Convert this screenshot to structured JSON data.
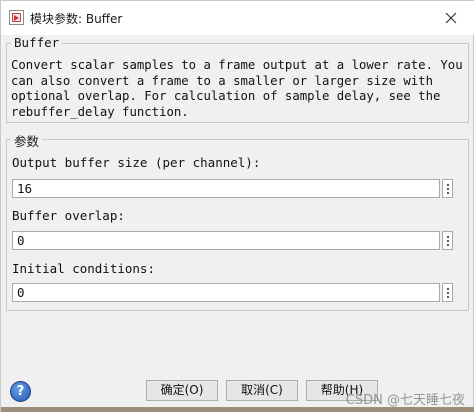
{
  "window": {
    "title": "模块参数: Buffer"
  },
  "description_group": {
    "label": "Buffer",
    "text": "Convert scalar samples to a frame output at a lower rate. You\ncan also convert a frame to a smaller or larger size with\noptional overlap. For calculation of sample delay, see the\nrebuffer_delay function."
  },
  "params_group": {
    "label": "参数",
    "fields": [
      {
        "label": "Output buffer size (per channel):",
        "value": "16"
      },
      {
        "label": "Buffer overlap:",
        "value": "0"
      },
      {
        "label": "Initial conditions:",
        "value": "0"
      }
    ]
  },
  "buttons": {
    "ok": "确定(O)",
    "cancel": "取消(C)",
    "help": "帮助(H)"
  },
  "watermark": "CSDN @七天睡七夜",
  "icons": {
    "app": "simulink-block-icon",
    "close": "close-icon",
    "help": "help-icon",
    "more": "more-options-icon"
  }
}
